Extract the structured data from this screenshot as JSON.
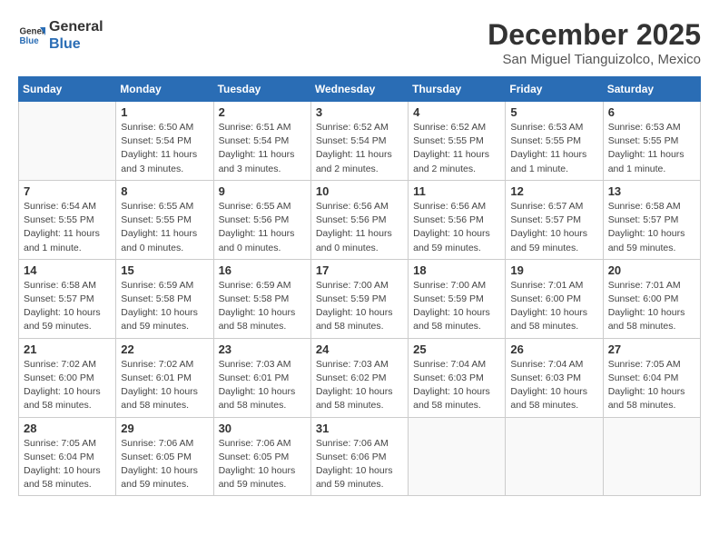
{
  "logo": {
    "line1": "General",
    "line2": "Blue"
  },
  "title": "December 2025",
  "subtitle": "San Miguel Tianguizolco, Mexico",
  "days_of_week": [
    "Sunday",
    "Monday",
    "Tuesday",
    "Wednesday",
    "Thursday",
    "Friday",
    "Saturday"
  ],
  "weeks": [
    [
      {
        "day": "",
        "info": ""
      },
      {
        "day": "1",
        "info": "Sunrise: 6:50 AM\nSunset: 5:54 PM\nDaylight: 11 hours and 3 minutes."
      },
      {
        "day": "2",
        "info": "Sunrise: 6:51 AM\nSunset: 5:54 PM\nDaylight: 11 hours and 3 minutes."
      },
      {
        "day": "3",
        "info": "Sunrise: 6:52 AM\nSunset: 5:54 PM\nDaylight: 11 hours and 2 minutes."
      },
      {
        "day": "4",
        "info": "Sunrise: 6:52 AM\nSunset: 5:55 PM\nDaylight: 11 hours and 2 minutes."
      },
      {
        "day": "5",
        "info": "Sunrise: 6:53 AM\nSunset: 5:55 PM\nDaylight: 11 hours and 1 minute."
      },
      {
        "day": "6",
        "info": "Sunrise: 6:53 AM\nSunset: 5:55 PM\nDaylight: 11 hours and 1 minute."
      }
    ],
    [
      {
        "day": "7",
        "info": "Sunrise: 6:54 AM\nSunset: 5:55 PM\nDaylight: 11 hours and 1 minute."
      },
      {
        "day": "8",
        "info": "Sunrise: 6:55 AM\nSunset: 5:55 PM\nDaylight: 11 hours and 0 minutes."
      },
      {
        "day": "9",
        "info": "Sunrise: 6:55 AM\nSunset: 5:56 PM\nDaylight: 11 hours and 0 minutes."
      },
      {
        "day": "10",
        "info": "Sunrise: 6:56 AM\nSunset: 5:56 PM\nDaylight: 11 hours and 0 minutes."
      },
      {
        "day": "11",
        "info": "Sunrise: 6:56 AM\nSunset: 5:56 PM\nDaylight: 10 hours and 59 minutes."
      },
      {
        "day": "12",
        "info": "Sunrise: 6:57 AM\nSunset: 5:57 PM\nDaylight: 10 hours and 59 minutes."
      },
      {
        "day": "13",
        "info": "Sunrise: 6:58 AM\nSunset: 5:57 PM\nDaylight: 10 hours and 59 minutes."
      }
    ],
    [
      {
        "day": "14",
        "info": "Sunrise: 6:58 AM\nSunset: 5:57 PM\nDaylight: 10 hours and 59 minutes."
      },
      {
        "day": "15",
        "info": "Sunrise: 6:59 AM\nSunset: 5:58 PM\nDaylight: 10 hours and 59 minutes."
      },
      {
        "day": "16",
        "info": "Sunrise: 6:59 AM\nSunset: 5:58 PM\nDaylight: 10 hours and 58 minutes."
      },
      {
        "day": "17",
        "info": "Sunrise: 7:00 AM\nSunset: 5:59 PM\nDaylight: 10 hours and 58 minutes."
      },
      {
        "day": "18",
        "info": "Sunrise: 7:00 AM\nSunset: 5:59 PM\nDaylight: 10 hours and 58 minutes."
      },
      {
        "day": "19",
        "info": "Sunrise: 7:01 AM\nSunset: 6:00 PM\nDaylight: 10 hours and 58 minutes."
      },
      {
        "day": "20",
        "info": "Sunrise: 7:01 AM\nSunset: 6:00 PM\nDaylight: 10 hours and 58 minutes."
      }
    ],
    [
      {
        "day": "21",
        "info": "Sunrise: 7:02 AM\nSunset: 6:00 PM\nDaylight: 10 hours and 58 minutes."
      },
      {
        "day": "22",
        "info": "Sunrise: 7:02 AM\nSunset: 6:01 PM\nDaylight: 10 hours and 58 minutes."
      },
      {
        "day": "23",
        "info": "Sunrise: 7:03 AM\nSunset: 6:01 PM\nDaylight: 10 hours and 58 minutes."
      },
      {
        "day": "24",
        "info": "Sunrise: 7:03 AM\nSunset: 6:02 PM\nDaylight: 10 hours and 58 minutes."
      },
      {
        "day": "25",
        "info": "Sunrise: 7:04 AM\nSunset: 6:03 PM\nDaylight: 10 hours and 58 minutes."
      },
      {
        "day": "26",
        "info": "Sunrise: 7:04 AM\nSunset: 6:03 PM\nDaylight: 10 hours and 58 minutes."
      },
      {
        "day": "27",
        "info": "Sunrise: 7:05 AM\nSunset: 6:04 PM\nDaylight: 10 hours and 58 minutes."
      }
    ],
    [
      {
        "day": "28",
        "info": "Sunrise: 7:05 AM\nSunset: 6:04 PM\nDaylight: 10 hours and 58 minutes."
      },
      {
        "day": "29",
        "info": "Sunrise: 7:06 AM\nSunset: 6:05 PM\nDaylight: 10 hours and 59 minutes."
      },
      {
        "day": "30",
        "info": "Sunrise: 7:06 AM\nSunset: 6:05 PM\nDaylight: 10 hours and 59 minutes."
      },
      {
        "day": "31",
        "info": "Sunrise: 7:06 AM\nSunset: 6:06 PM\nDaylight: 10 hours and 59 minutes."
      },
      {
        "day": "",
        "info": ""
      },
      {
        "day": "",
        "info": ""
      },
      {
        "day": "",
        "info": ""
      }
    ]
  ]
}
